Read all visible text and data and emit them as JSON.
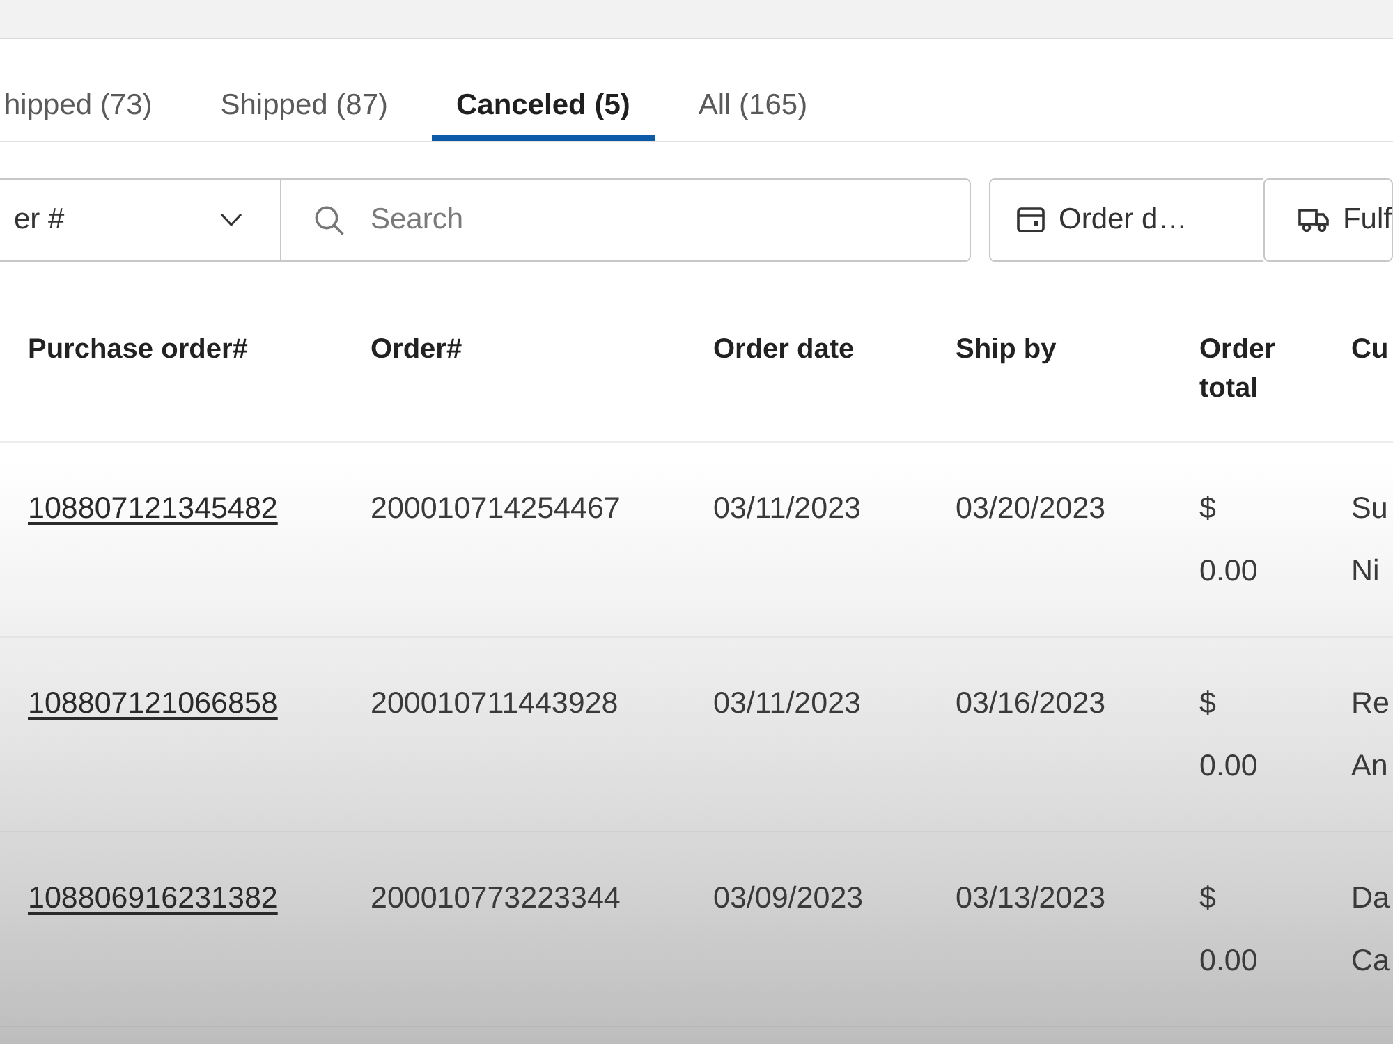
{
  "tabs": [
    {
      "label": "hipped (73)",
      "selected": false
    },
    {
      "label": "Shipped (87)",
      "selected": false
    },
    {
      "label": "Canceled (5)",
      "selected": true
    },
    {
      "label": "All (165)",
      "selected": false
    }
  ],
  "filters": {
    "dropdown": {
      "value": "er #"
    },
    "search": {
      "placeholder": "Search"
    },
    "buttons": [
      {
        "label": "Order d…",
        "kind": "calendar"
      },
      {
        "label": "Fulf",
        "kind": "truck"
      }
    ]
  },
  "table": {
    "columns": [
      "Purchase order#",
      "Order#",
      "Order date",
      "Ship by",
      "Order total",
      "Cu"
    ],
    "rows": [
      {
        "purchase_order": "108807121345482",
        "order": "200010714254467",
        "order_date": "03/11/2023",
        "ship_by": "03/20/2023",
        "order_total": "$ 0.00",
        "customer": [
          "Su",
          "Ni"
        ]
      },
      {
        "purchase_order": "108807121066858",
        "order": "200010711443928",
        "order_date": "03/11/2023",
        "ship_by": "03/16/2023",
        "order_total": "$ 0.00",
        "customer": [
          "Re",
          "An"
        ]
      },
      {
        "purchase_order": "108806916231382",
        "order": "200010773223344",
        "order_date": "03/09/2023",
        "ship_by": "03/13/2023",
        "order_total": "$ 0.00",
        "customer": [
          "Da",
          "Ca"
        ]
      }
    ]
  }
}
